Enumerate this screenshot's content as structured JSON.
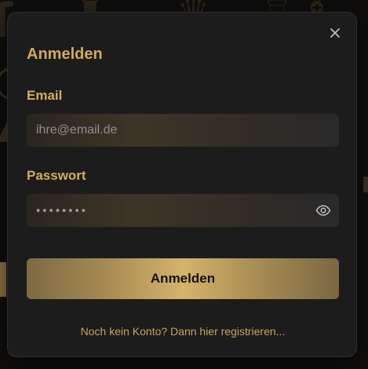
{
  "colors": {
    "accent": "#d6ac5d",
    "modal_bg": "#1c1c1c",
    "button_gradient_center": "#d6b36a",
    "button_text": "#121212"
  },
  "modal": {
    "title": "Anmelden",
    "close_icon": "close-icon",
    "email": {
      "label": "Email",
      "placeholder": "ihre@email.de",
      "value": ""
    },
    "password": {
      "label": "Passwort",
      "value": "••••••••",
      "toggle_icon": "eye-icon"
    },
    "submit_label": "Anmelden",
    "register_link": "Noch kein Konto? Dann hier registrieren..."
  }
}
